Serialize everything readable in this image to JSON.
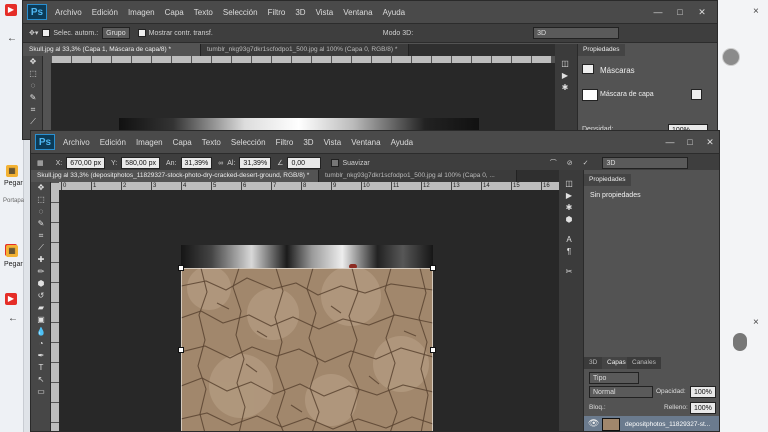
{
  "back_window": {
    "menu": [
      "Archivo",
      "Edición",
      "Imagen",
      "Capa",
      "Texto",
      "Selección",
      "Filtro",
      "3D",
      "Vista",
      "Ventana",
      "Ayuda"
    ],
    "options": {
      "auto_select": "Selec. autom.:",
      "group": "Grupo",
      "transform": "Mostrar contr. transf.",
      "mode3d": "Modo 3D:",
      "workspace": "3D"
    },
    "tabs": [
      "Skull.jpg al 33,3% (Capa 1, Máscara de capa/8) *",
      "tumblr_nkg93g7dkr1scfodpo1_500.jpg al 100% (Capa 0, RGB/8) *"
    ],
    "properties": {
      "header": "Propiedades",
      "section": "Máscaras",
      "mask_label": "Máscara de capa",
      "density_label": "Densidad:",
      "density_value": "100%"
    }
  },
  "front_window": {
    "menu": [
      "Archivo",
      "Edición",
      "Imagen",
      "Capa",
      "Texto",
      "Selección",
      "Filtro",
      "3D",
      "Vista",
      "Ventana",
      "Ayuda"
    ],
    "options": {
      "x_label": "X:",
      "x_value": "670,00 px",
      "y_label": "Y:",
      "y_value": "580,00 px",
      "w_label": "An:",
      "w_value": "31,39%",
      "h_label": "Al:",
      "h_value": "31,39%",
      "angle_value": "0,00",
      "smooth": "Suavizar",
      "workspace": "3D"
    },
    "tabs": [
      "Skull.jpg al 33,3% (depositphotos_11829327-stock-photo-dry-cracked-desert-ground, RGB/8) *",
      "tumblr_nkg93g7dkr1scfodpo1_500.jpg al 100% (Capa 0, ..."
    ],
    "ruler_marks": [
      "0",
      "1",
      "2",
      "3",
      "4",
      "5",
      "6",
      "7",
      "8",
      "9",
      "10",
      "11",
      "12",
      "13",
      "14",
      "15",
      "16"
    ],
    "properties": {
      "header": "Propiedades",
      "empty": "Sin propiedades"
    },
    "layers": {
      "tabs": [
        "3D",
        "Capas",
        "Canales"
      ],
      "kind": "Tipo",
      "blend": "Normal",
      "opacity_label": "Opacidad:",
      "opacity_value": "100%",
      "lock_label": "Bloq.:",
      "fill_label": "Relleno:",
      "fill_value": "100%",
      "layer_name": "depositphotos_11829327-st..."
    }
  },
  "taskbar": {
    "items": [
      "Pegar",
      "Portapa",
      "Pegar"
    ]
  },
  "colors": {
    "ps_bg": "#535353",
    "canvas": "#282828",
    "accent": "#4fb7f2",
    "dirt": "#9b7d61"
  }
}
